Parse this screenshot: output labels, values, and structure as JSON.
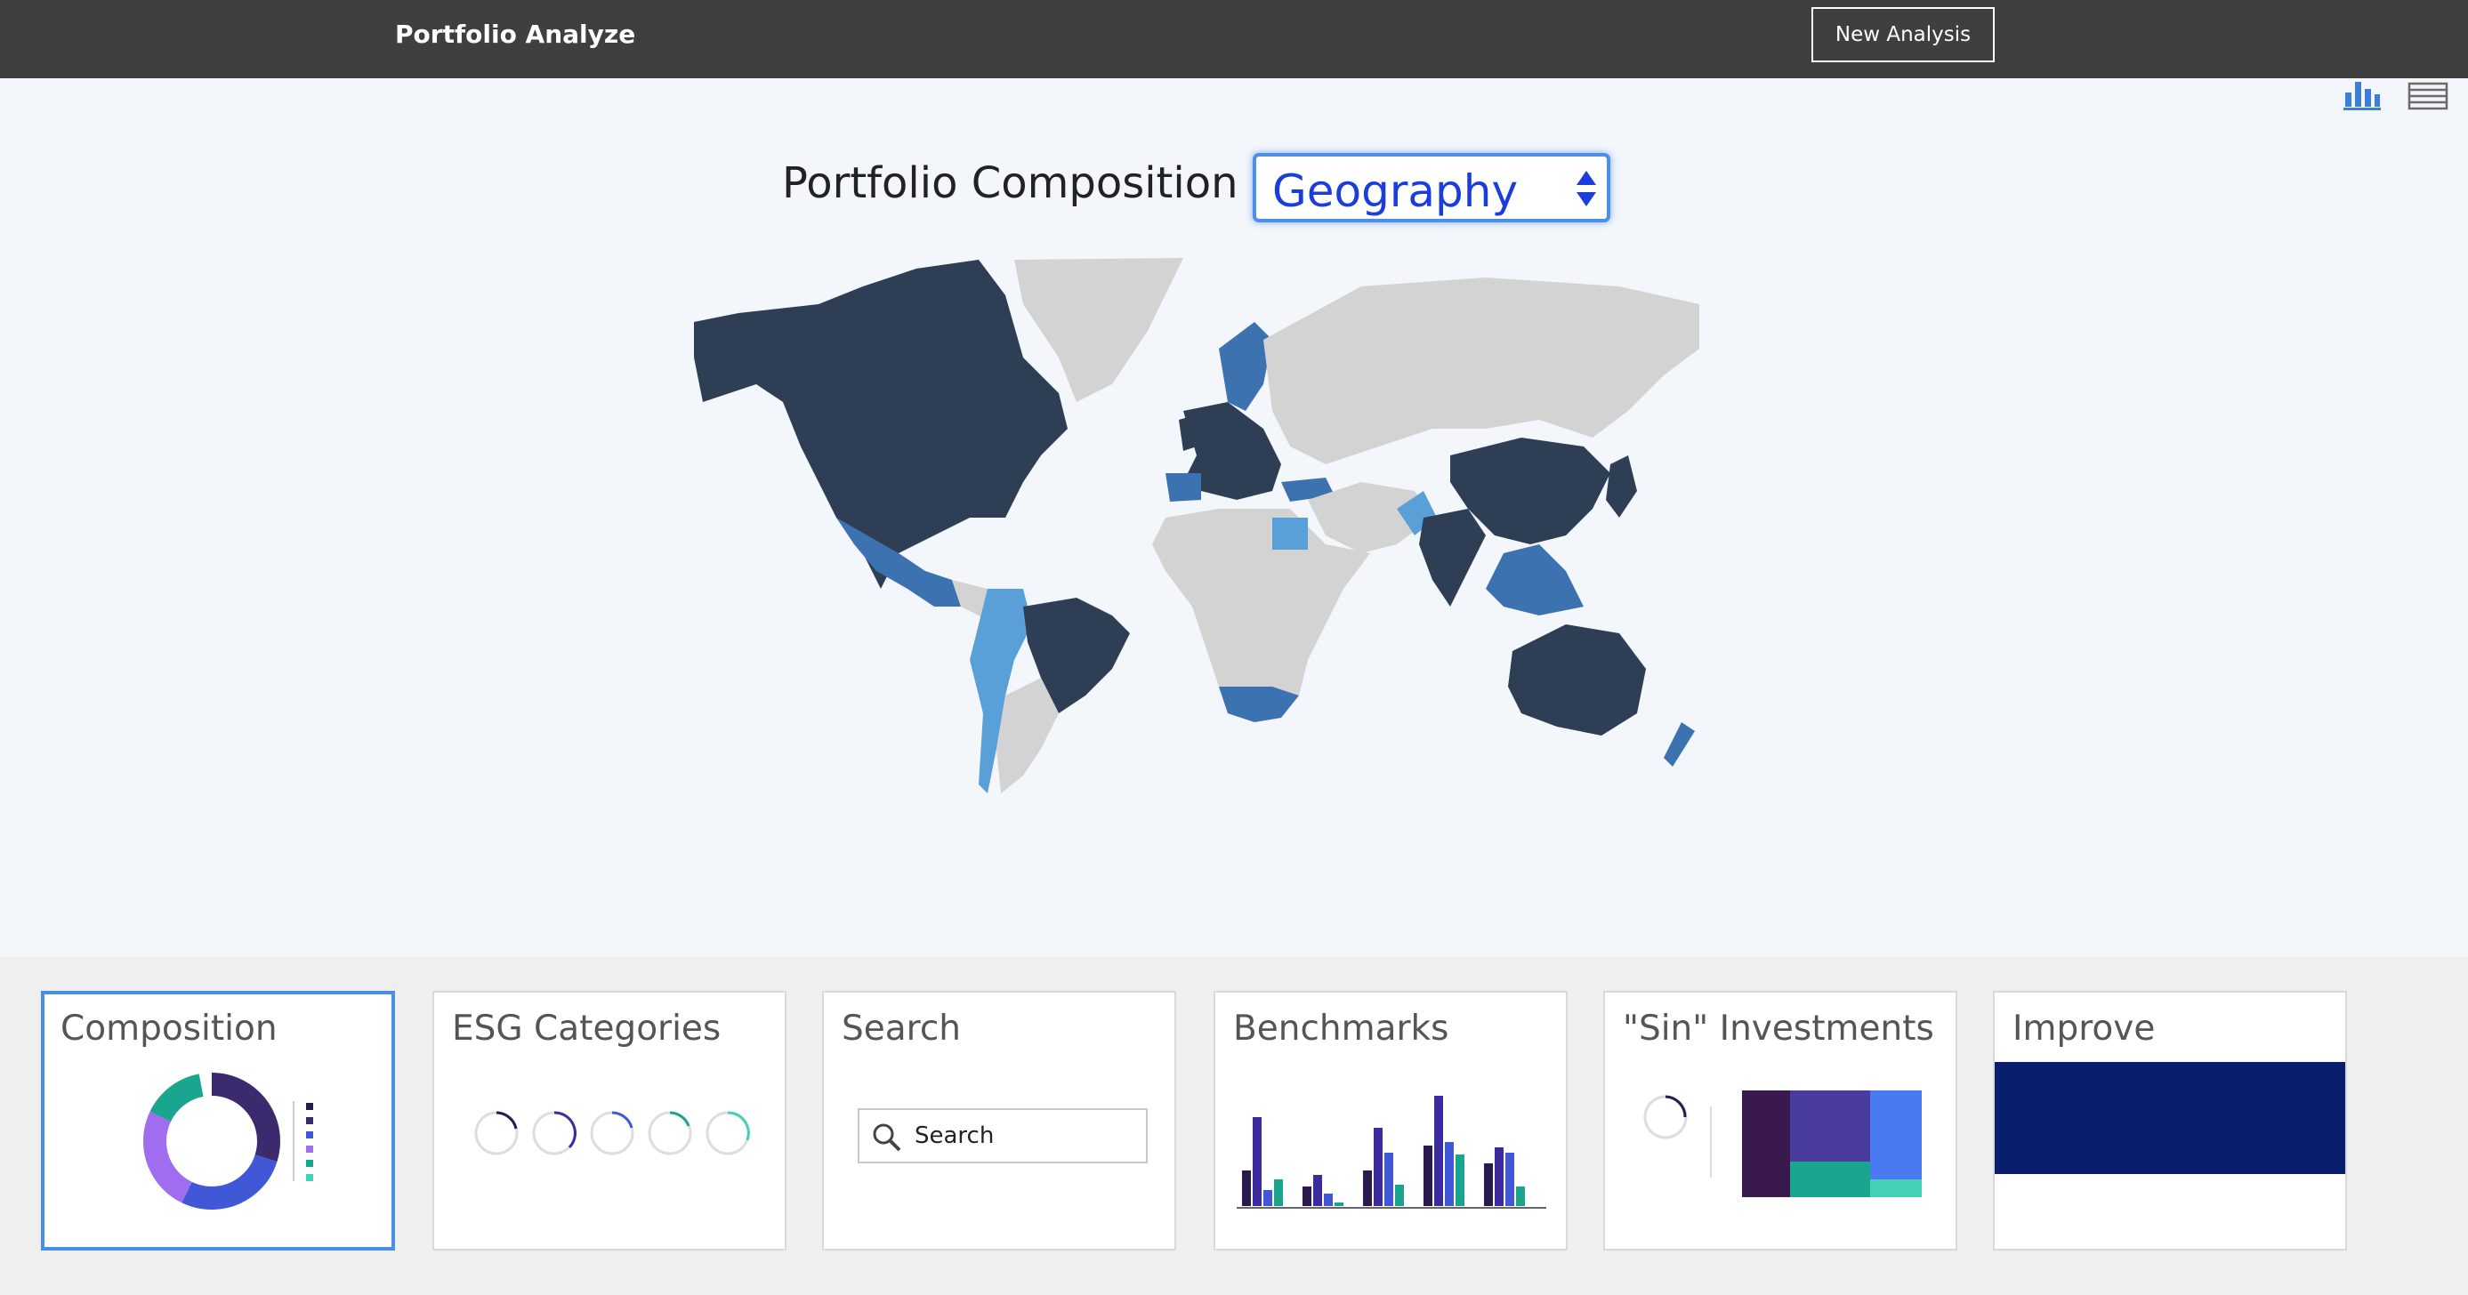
{
  "header": {
    "app_title": "Portfolio Analyze",
    "new_analysis_label": "New Analysis"
  },
  "view_toggles": [
    {
      "icon": "bar-chart-icon",
      "active": true
    },
    {
      "icon": "list-view-icon",
      "active": false
    }
  ],
  "composition": {
    "heading": "Portfolio Composition by",
    "dimension_selected": "Geography",
    "map_colors": {
      "dark": "#2d3e55",
      "medium": "#3d72b0",
      "light": "#5aa0d8",
      "none": "#d3d3d3"
    }
  },
  "cards": [
    {
      "title": "Composition"
    },
    {
      "title": "ESG Categories"
    },
    {
      "title": "Search",
      "search_placeholder": "Search"
    },
    {
      "title": "Benchmarks"
    },
    {
      "title": "\"Sin\" Investments"
    },
    {
      "title": "Improve"
    }
  ],
  "colors": {
    "topbar": "#3f3f3f",
    "accent": "#4a90e2",
    "select_text": "#1a3ddb",
    "improve": "#0a1e6e"
  }
}
